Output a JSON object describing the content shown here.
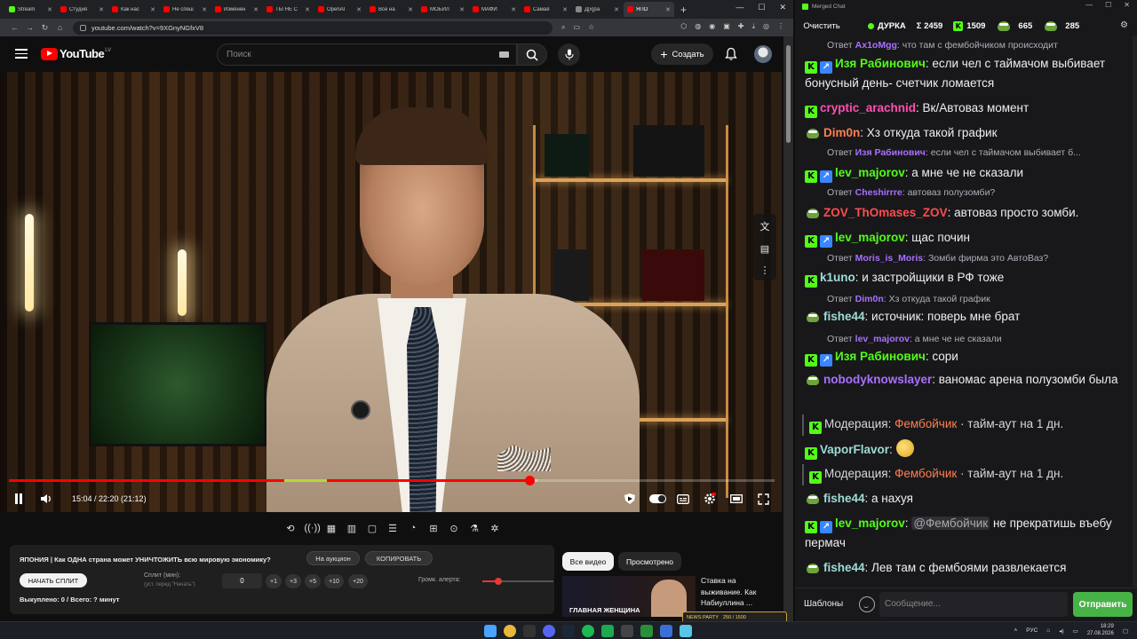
{
  "browser": {
    "tabs": [
      {
        "label": "Stream",
        "color": "#53fc18"
      },
      {
        "label": "Студия",
        "color": "#ff0000"
      },
      {
        "label": "Как нас",
        "color": "#ff0000"
      },
      {
        "label": "Не спеш",
        "color": "#ff0000"
      },
      {
        "label": "Изменен",
        "color": "#ff0000"
      },
      {
        "label": "ТЫ НЕ С",
        "color": "#ff0000"
      },
      {
        "label": "OpenAI",
        "color": "#ff0000"
      },
      {
        "label": "Все на",
        "color": "#ff0000"
      },
      {
        "label": "МОБИЛ",
        "color": "#ff0000"
      },
      {
        "label": "МАФИ",
        "color": "#ff0000"
      },
      {
        "label": "Самая",
        "color": "#ff0000"
      },
      {
        "label": "Д[х]ра",
        "color": "#888888"
      },
      {
        "label": "ЯПО",
        "color": "#ff0000"
      }
    ],
    "url": "youtube.com/watch?v=9XGnyNGfxV8"
  },
  "youtube": {
    "logo_text": "YouTube",
    "country": "LV",
    "search_placeholder": "Поиск",
    "create_label": "Создать"
  },
  "player": {
    "time": "15:04 / 22:20 (21:12)",
    "played_fraction": 0.68,
    "loaded_fraction": 0.69
  },
  "split": {
    "title": "ЯПОНИЯ | Как ОДНА страна может УНИЧТОЖИТЬ всю мировую экономику?",
    "auction_label": "На аукцион",
    "copy_label": "КОПИРОВАТЬ",
    "start_label": "НАЧАТЬ СПЛИТ",
    "split_min_label": "Сплит (мин):",
    "split_min_hint": "(уст. перед \"Начать\")",
    "split_min_value": "0",
    "increments": [
      "+1",
      "+3",
      "+5",
      "+10",
      "+20"
    ],
    "alert_volume_label": "Громк. алерта:",
    "alert_volume_fraction": 0.22,
    "footer": "Выкуплено: 0 / Всего: ? минут"
  },
  "related": {
    "chip_all": "Все видео",
    "chip_watched": "Просмотрено",
    "thumb_caption": "ГЛАВНАЯ ЖЕНЩИНА",
    "title": "Ставка на выживание. Как Набиуллина ..."
  },
  "party": {
    "label": "NEWS PARTY",
    "count": "250 / 1500"
  },
  "chat": {
    "window_title": "Merged Chat",
    "clear_label": "Очистить",
    "channel": "ДУРКА",
    "total": "Σ 2459",
    "kick_count": "1509",
    "other_count": "665",
    "third_count": "285",
    "templates_label": "Шаблоны",
    "input_placeholder": "Сообщение...",
    "send_label": "Отправить",
    "colors": {
      "green": "#53fc18",
      "purple": "#a970ff",
      "orange": "#ff7f50",
      "teal": "#9edcd6"
    },
    "messages": [
      {
        "kind": "reply",
        "prefix": "Ответ",
        "user": "Ax1oMgg",
        "user_color": "#a970ff",
        "text": ": что там с фембойчиком происходит"
      },
      {
        "kind": "msg",
        "badges": [
          "kick",
          "blue"
        ],
        "user": "Изя Рабинович",
        "user_color": "#53fc18",
        "text": ": если чел с таймачом выбивает бонусный день- счетчик ломается"
      },
      {
        "kind": "msg",
        "badges": [
          "kick"
        ],
        "user": "cryptic_arachnid",
        "user_color": "#ff4fb0",
        "text": ": Вк/Автоваз момент"
      },
      {
        "kind": "msg",
        "badges": [
          "pepe"
        ],
        "user": "Dim0n",
        "user_color": "#ff7f50",
        "text": ": Хз откуда такой график"
      },
      {
        "kind": "reply",
        "prefix": "Ответ",
        "user": "Изя Рабинович",
        "user_color": "#a970ff",
        "text": ": если чел с таймачом выбивает б..."
      },
      {
        "kind": "msg",
        "badges": [
          "kick",
          "blue"
        ],
        "user": "lev_majorov",
        "user_color": "#53fc18",
        "text": ": а мне че не сказали"
      },
      {
        "kind": "reply",
        "prefix": "Ответ",
        "user": "Cheshirrre",
        "user_color": "#a970ff",
        "text": ": автоваз полузомби?"
      },
      {
        "kind": "msg",
        "badges": [
          "pepe"
        ],
        "user": "ZOV_ThOmases_ZOV",
        "user_color": "#ff4d4d",
        "text": ": автоваз просто зомби."
      },
      {
        "kind": "msg",
        "badges": [
          "kick",
          "blue"
        ],
        "user": "lev_majorov",
        "user_color": "#53fc18",
        "text": ": щас почин"
      },
      {
        "kind": "reply",
        "prefix": "Ответ",
        "user": "Moris_is_Moris",
        "user_color": "#a970ff",
        "text": ": Зомби фирма это АвтоВаз?"
      },
      {
        "kind": "msg",
        "badges": [
          "kick"
        ],
        "user": "k1uno",
        "user_color": "#9edcd6",
        "text": ": и застройщики в РФ тоже"
      },
      {
        "kind": "reply",
        "prefix": "Ответ",
        "user": "Dim0n",
        "user_color": "#a970ff",
        "text": ": Хз откуда такой график"
      },
      {
        "kind": "msg",
        "badges": [
          "pepe"
        ],
        "user": "fishe44",
        "user_color": "#9edcd6",
        "text": ": источник: поверь мне брат"
      },
      {
        "kind": "reply",
        "prefix": "Ответ",
        "user": "lev_majorov",
        "user_color": "#a970ff",
        "text": ": а мне че не сказали"
      },
      {
        "kind": "msg",
        "badges": [
          "kick",
          "blue"
        ],
        "user": "Изя Рабинович",
        "user_color": "#53fc18",
        "text": ": сори"
      },
      {
        "kind": "msg",
        "badges": [
          "pepe"
        ],
        "user": "nobodyknowslayer",
        "user_color": "#a970ff",
        "text": ": ваномас арена полузомби была"
      },
      {
        "kind": "mod",
        "badges": [
          "kick"
        ],
        "prefix": "Модерация:",
        "user": "Фембойчик",
        "user_color": "#ff7f50",
        "text": " · тайм-аут на 1 дн."
      },
      {
        "kind": "msg",
        "badges": [
          "kick"
        ],
        "user": "VaporFlavor",
        "user_color": "#9edcd6",
        "text": ": ",
        "emote": true
      },
      {
        "kind": "mod",
        "badges": [
          "kick"
        ],
        "prefix": "Модерация:",
        "user": "Фембойчик",
        "user_color": "#ff7f50",
        "text": " · тайм-аут на 1 дн."
      },
      {
        "kind": "msg",
        "badges": [
          "pepe"
        ],
        "user": "fishe44",
        "user_color": "#9edcd6",
        "text": ": а нахуя"
      },
      {
        "kind": "msg",
        "badges": [
          "kick",
          "blue"
        ],
        "user": "lev_majorov",
        "user_color": "#53fc18",
        "text": ": ",
        "mention": "@Фембойчик",
        "text2": " не прекратишь въебу пермач"
      },
      {
        "kind": "msg",
        "badges": [
          "pepe"
        ],
        "user": "fishe44",
        "user_color": "#9edcd6",
        "text": ": Лев там с фембоями развлекается"
      }
    ]
  },
  "taskbar": {
    "lang": "РУС",
    "time": "18:29",
    "date": "27.08.2026"
  }
}
